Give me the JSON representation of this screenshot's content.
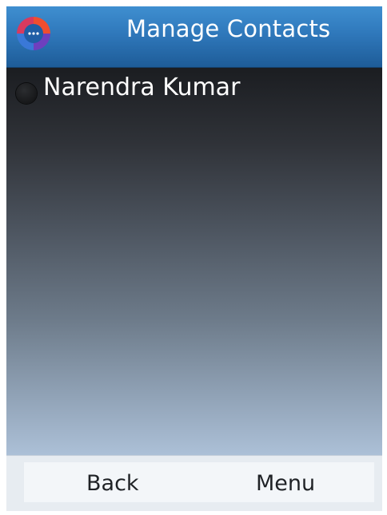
{
  "header": {
    "title": "Manage Contacts",
    "logo_icon": "app-logo-icon",
    "colors": {
      "bar_top": "#3f8fd0",
      "bar_bottom": "#1e5c98"
    }
  },
  "contacts": [
    {
      "name": "Narendra Kumar",
      "selected": false,
      "icon": "radio-unselected-icon"
    }
  ],
  "softkeys": {
    "left": "Back",
    "right": "Menu"
  },
  "theme": {
    "content_gradient_top": "#1b1d21",
    "content_gradient_bottom": "#acc0d7",
    "text_light": "#ffffff",
    "text_dark": "#1f2226"
  }
}
